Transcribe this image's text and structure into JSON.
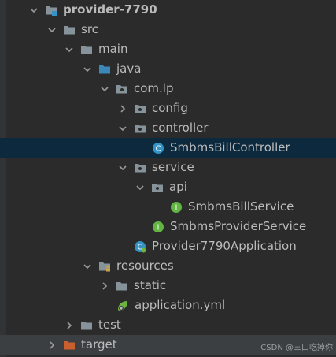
{
  "tree": {
    "items": [
      {
        "label": "provider-7790",
        "state": "expanded",
        "icon": "module-folder-icon",
        "bold": true
      },
      {
        "label": "src",
        "state": "expanded",
        "icon": "folder-icon"
      },
      {
        "label": "main",
        "state": "expanded",
        "icon": "folder-icon"
      },
      {
        "label": "java",
        "state": "expanded",
        "icon": "source-root-folder-icon"
      },
      {
        "label": "com.lp",
        "state": "expanded",
        "icon": "package-icon"
      },
      {
        "label": "config",
        "state": "collapsed",
        "icon": "package-icon"
      },
      {
        "label": "controller",
        "state": "expanded",
        "icon": "package-icon"
      },
      {
        "label": "SmbmsBillController",
        "state": "leaf",
        "icon": "class-icon",
        "selected": true
      },
      {
        "label": "service",
        "state": "expanded",
        "icon": "package-icon"
      },
      {
        "label": "api",
        "state": "expanded",
        "icon": "package-icon"
      },
      {
        "label": "SmbmsBillService",
        "state": "leaf",
        "icon": "interface-icon"
      },
      {
        "label": "SmbmsProviderService",
        "state": "leaf",
        "icon": "interface-icon"
      },
      {
        "label": "Provider7790Application",
        "state": "leaf",
        "icon": "spring-boot-class-icon"
      },
      {
        "label": "resources",
        "state": "expanded",
        "icon": "resources-folder-icon"
      },
      {
        "label": "static",
        "state": "collapsed",
        "icon": "folder-icon"
      },
      {
        "label": "application.yml",
        "state": "leaf",
        "icon": "spring-config-yml-icon"
      },
      {
        "label": "test",
        "state": "collapsed",
        "icon": "folder-icon"
      },
      {
        "label": "target",
        "state": "collapsed",
        "icon": "excluded-folder-icon",
        "orange": true
      }
    ]
  },
  "watermark": "CSDN @三口吃掉你",
  "colors": {
    "background": "#2b2b2b",
    "selection": "#0d293e",
    "text": "#bbbbbb",
    "class_icon": "#3592c4",
    "interface_icon": "#62b543",
    "excluded_folder": "#c95f2e"
  }
}
